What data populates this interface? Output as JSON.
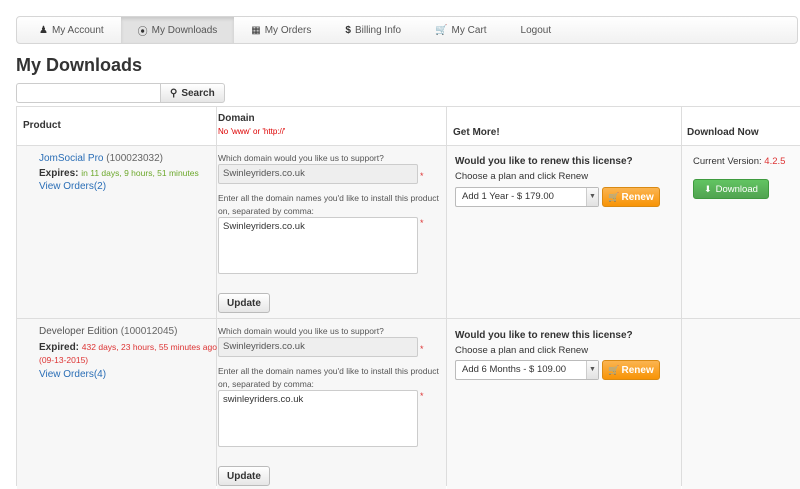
{
  "nav": {
    "items": [
      {
        "label": "My Account",
        "icon": "user-icon"
      },
      {
        "label": "My Downloads",
        "icon": "download-icon"
      },
      {
        "label": "My Orders",
        "icon": "orders-icon"
      },
      {
        "label": "Billing Info",
        "icon": "dollar-icon"
      },
      {
        "label": "My Cart",
        "icon": "cart-icon"
      },
      {
        "label": "Logout",
        "icon": ""
      }
    ],
    "active": "My Downloads"
  },
  "page_title": "My Downloads",
  "search": {
    "placeholder": "",
    "value": "",
    "button_label": "Search"
  },
  "table": {
    "headers": {
      "product": "Product",
      "domain": "Domain",
      "domain_note": "No 'www' or 'http://'",
      "get_more": "Get More!",
      "download_now": "Download Now"
    }
  },
  "rows": [
    {
      "product_name": "JomSocial Pro",
      "product_id": "(100023032)",
      "expires_label": "Expires:",
      "expires_value": "in 11 days, 9 hours, 51 minutes",
      "view_orders": "View Orders(2)",
      "domain_question": "Which domain would you like us to support?",
      "domain_value": "Swinleyriders.co.uk",
      "domains_label": "Enter all the domain names you'd like to install this product on, separated by comma:",
      "domains_value": "Swinleyriders.co.uk",
      "required_mark": "*",
      "update_label": "Update",
      "renew_title": "Would you like to renew this license?",
      "renew_sub": "Choose a plan and click Renew",
      "plan_selected": "Add 1 Year - $ 179.00",
      "renew_label": "Renew",
      "current_version_label": "Current Version:",
      "current_version": "4.2.5",
      "download_label": "Download"
    },
    {
      "product_name": "Developer Edition",
      "product_id": "(100012045)",
      "expires_label": "Expired:",
      "expires_value": "432 days, 23 hours, 55 minutes ago (09-13-2015)",
      "view_orders": "View Orders(4)",
      "domain_question": "Which domain would you like us to support?",
      "domain_value": "Swinleyriders.co.uk",
      "domains_label": "Enter all the domain names you'd like to install this product on, separated by comma:",
      "domains_value": "swinleyriders.co.uk",
      "required_mark": "*",
      "update_label": "Update",
      "renew_title": "Would you like to renew this license?",
      "renew_sub": "Choose a plan and click Renew",
      "plan_selected": "Add 6 Months - $ 109.00",
      "renew_label": "Renew"
    }
  ],
  "colors": {
    "accent": "#2a6eb6",
    "renew": "#f89406",
    "download": "#51a351",
    "expired": "#dd3333",
    "active_green": "#6ca82b"
  }
}
